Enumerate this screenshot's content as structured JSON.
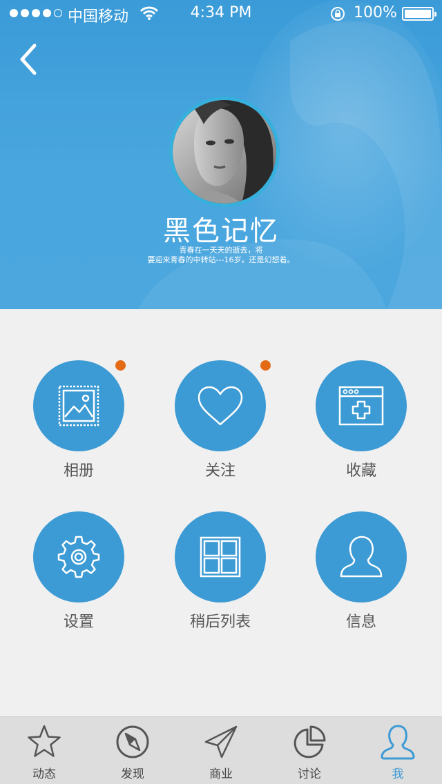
{
  "status_bar": {
    "carrier": "中国移动",
    "time": "4:34 PM",
    "battery_percent": "100%"
  },
  "profile": {
    "name": "黑色记忆",
    "bio_line1": "青春在一天天的逝去，将",
    "bio_line2": "要迎来青春的中转站---16岁。还是幻想着。"
  },
  "grid": {
    "items": [
      {
        "label": "相册",
        "icon": "album-icon",
        "badge": true
      },
      {
        "label": "关注",
        "icon": "heart-icon",
        "badge": true
      },
      {
        "label": "收藏",
        "icon": "add-window-icon",
        "badge": false
      },
      {
        "label": "设置",
        "icon": "gear-icon",
        "badge": false
      },
      {
        "label": "稍后列表",
        "icon": "grid-icon",
        "badge": false
      },
      {
        "label": "信息",
        "icon": "user-icon",
        "badge": false
      }
    ]
  },
  "tabbar": {
    "tabs": [
      {
        "label": "动态",
        "icon": "star-icon"
      },
      {
        "label": "发现",
        "icon": "compass-icon"
      },
      {
        "label": "商业",
        "icon": "paper-plane-icon"
      },
      {
        "label": "讨论",
        "icon": "pie-chart-icon"
      },
      {
        "label": "我",
        "icon": "person-icon",
        "active": true
      }
    ]
  },
  "colors": {
    "primary": "#3c9ad4",
    "badge": "#e46b15",
    "background": "#f0f0f0",
    "tabbar_bg": "#dddddd"
  }
}
